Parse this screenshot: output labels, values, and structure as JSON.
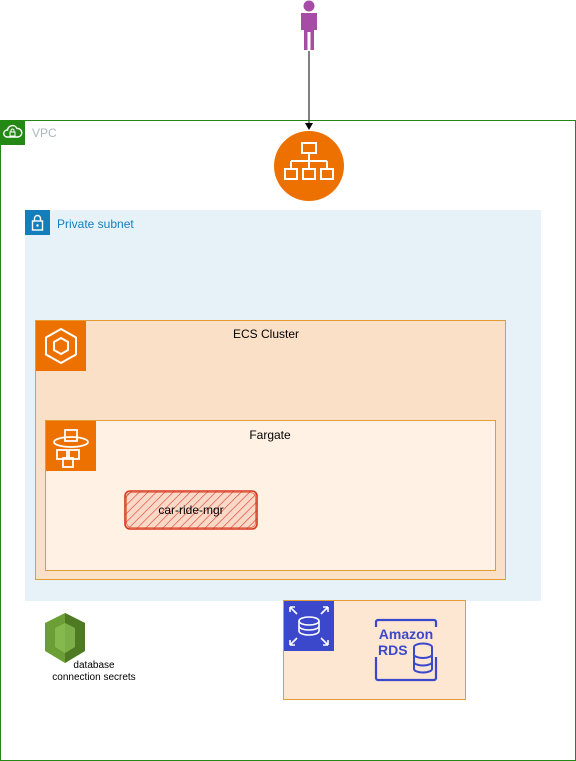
{
  "vpc": {
    "label": "VPC"
  },
  "subnet": {
    "label": "Private subnet"
  },
  "ecs": {
    "label": "ECS Cluster"
  },
  "fargate": {
    "label": "Fargate"
  },
  "task": {
    "label": "car-ride-mgr"
  },
  "secrets": {
    "label": "database connection secrets"
  },
  "rds": {
    "logo_line1": "Amazon",
    "logo_line2": "RDS"
  },
  "colors": {
    "vpc_border": "#248814",
    "subnet_fill": "#e6f2f8",
    "subnet_accent": "#147eba",
    "ecs_fill": "#fbe0c8",
    "fargate_fill": "#fff2e4",
    "compute_orange": "#ed7100",
    "task_stroke": "#d6371e",
    "database_blue": "#3b48cc",
    "secrets_green": "#6b9f35",
    "user_purple": "#a64ca6"
  },
  "icons": [
    "vpc-cloud-icon",
    "lock-icon",
    "ecs-icon",
    "fargate-icon",
    "user-icon",
    "load-balancer-icon",
    "secrets-manager-icon",
    "rds-icon",
    "amazon-rds-logo"
  ]
}
